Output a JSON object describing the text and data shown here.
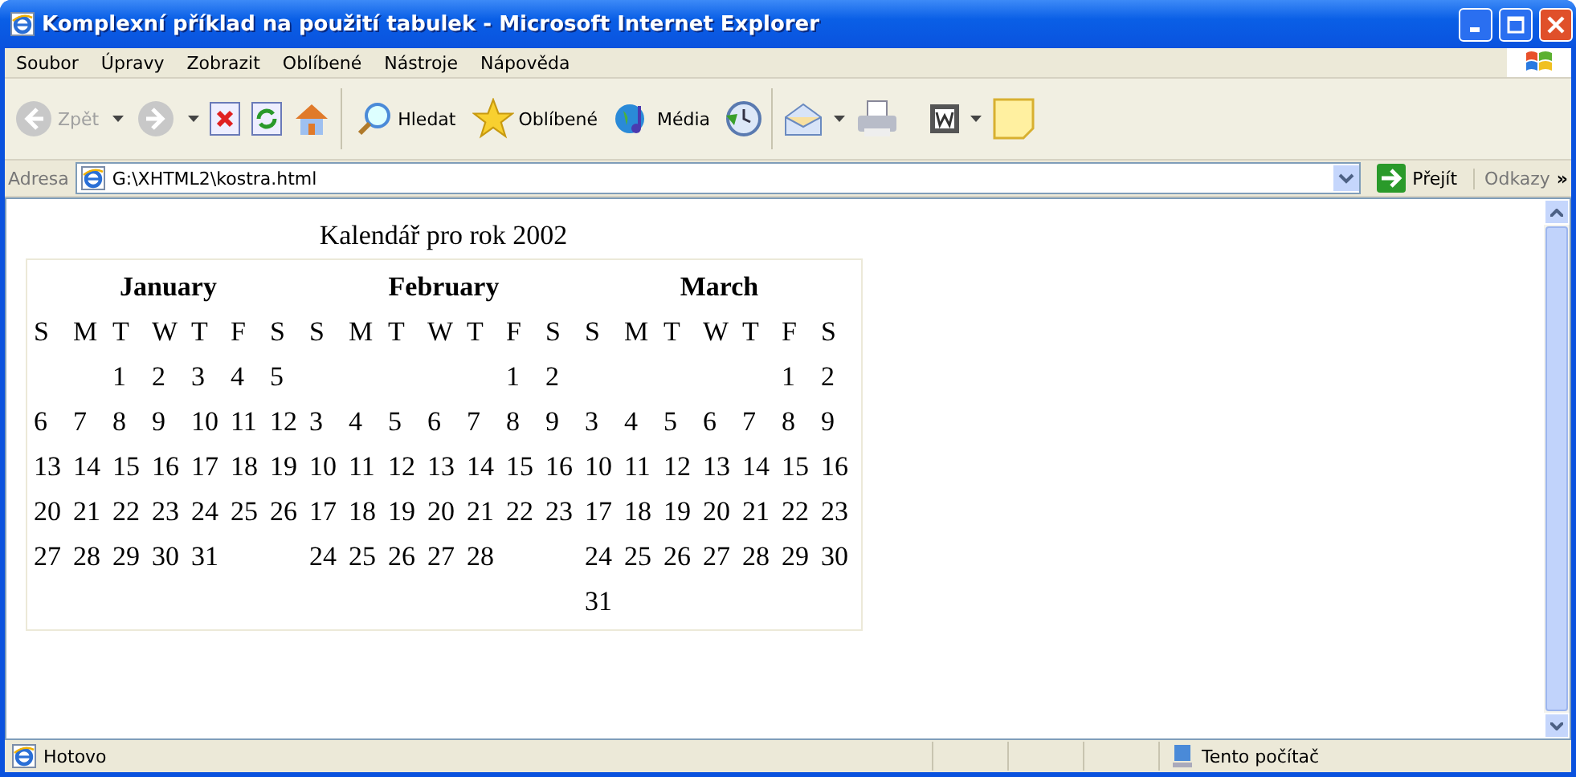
{
  "window": {
    "title": "Komplexní příklad na použití tabulek - Microsoft Internet Explorer"
  },
  "menu": [
    "Soubor",
    "Úpravy",
    "Zobrazit",
    "Oblíbené",
    "Nástroje",
    "Nápověda"
  ],
  "toolbar": {
    "back": {
      "label": "Zpět",
      "disabled": true
    },
    "forward": {
      "disabled": true
    },
    "search": {
      "label": "Hledat"
    },
    "favorites": {
      "label": "Oblíbené"
    },
    "media": {
      "label": "Média"
    }
  },
  "address_bar": {
    "label": "Adresa",
    "value": "G:\\XHTML2\\kostra.html",
    "go": "Přejít",
    "links": "Odkazy",
    "more": "»"
  },
  "page": {
    "caption": "Kalendář pro rok 2002",
    "months": [
      {
        "name": "January",
        "weekdays": [
          "S",
          "M",
          "T",
          "W",
          "T",
          "F",
          "S"
        ],
        "weeks": [
          {
            "kind": "first",
            "days": [
              "1",
              "2",
              "3",
              "4",
              "5"
            ]
          },
          {
            "kind": "week",
            "days": [
              "6",
              "7",
              "8",
              "9",
              "10",
              "11",
              "12"
            ]
          },
          {
            "kind": "week",
            "days": [
              "13",
              "14",
              "15",
              "16",
              "17",
              "18",
              "19"
            ]
          },
          {
            "kind": "week",
            "days": [
              "20",
              "21",
              "22",
              "23",
              "24",
              "25",
              "26"
            ]
          },
          {
            "kind": "week",
            "days": [
              "27",
              "28",
              "29",
              "30",
              "31"
            ]
          }
        ]
      },
      {
        "name": "February",
        "weekdays": [
          "S",
          "M",
          "T",
          "W",
          "T",
          "F",
          "S"
        ],
        "weeks": [
          {
            "kind": "first",
            "days": [
              "1",
              "2"
            ]
          },
          {
            "kind": "week",
            "days": [
              "3",
              "4",
              "5",
              "6",
              "7",
              "8",
              "9"
            ]
          },
          {
            "kind": "week",
            "days": [
              "10",
              "11",
              "12",
              "13",
              "14",
              "15",
              "16"
            ]
          },
          {
            "kind": "week",
            "days": [
              "17",
              "18",
              "19",
              "20",
              "21",
              "22",
              "23"
            ]
          },
          {
            "kind": "week",
            "days": [
              "24",
              "25",
              "26",
              "27",
              "28"
            ]
          }
        ]
      },
      {
        "name": "March",
        "weekdays": [
          "S",
          "M",
          "T",
          "W",
          "T",
          "F",
          "S"
        ],
        "weeks": [
          {
            "kind": "first",
            "days": [
              "1",
              "2"
            ]
          },
          {
            "kind": "week",
            "days": [
              "3",
              "4",
              "5",
              "6",
              "7",
              "8",
              "9"
            ]
          },
          {
            "kind": "week",
            "days": [
              "10",
              "11",
              "12",
              "13",
              "14",
              "15",
              "16"
            ]
          },
          {
            "kind": "week",
            "days": [
              "17",
              "18",
              "19",
              "20",
              "21",
              "22",
              "23"
            ]
          },
          {
            "kind": "week",
            "days": [
              "24",
              "25",
              "26",
              "27",
              "28",
              "29",
              "30"
            ]
          },
          {
            "kind": "week",
            "days": [
              "31"
            ]
          }
        ]
      }
    ]
  },
  "status_bar": {
    "text": "Hotovo",
    "zone": "Tento počítač"
  }
}
